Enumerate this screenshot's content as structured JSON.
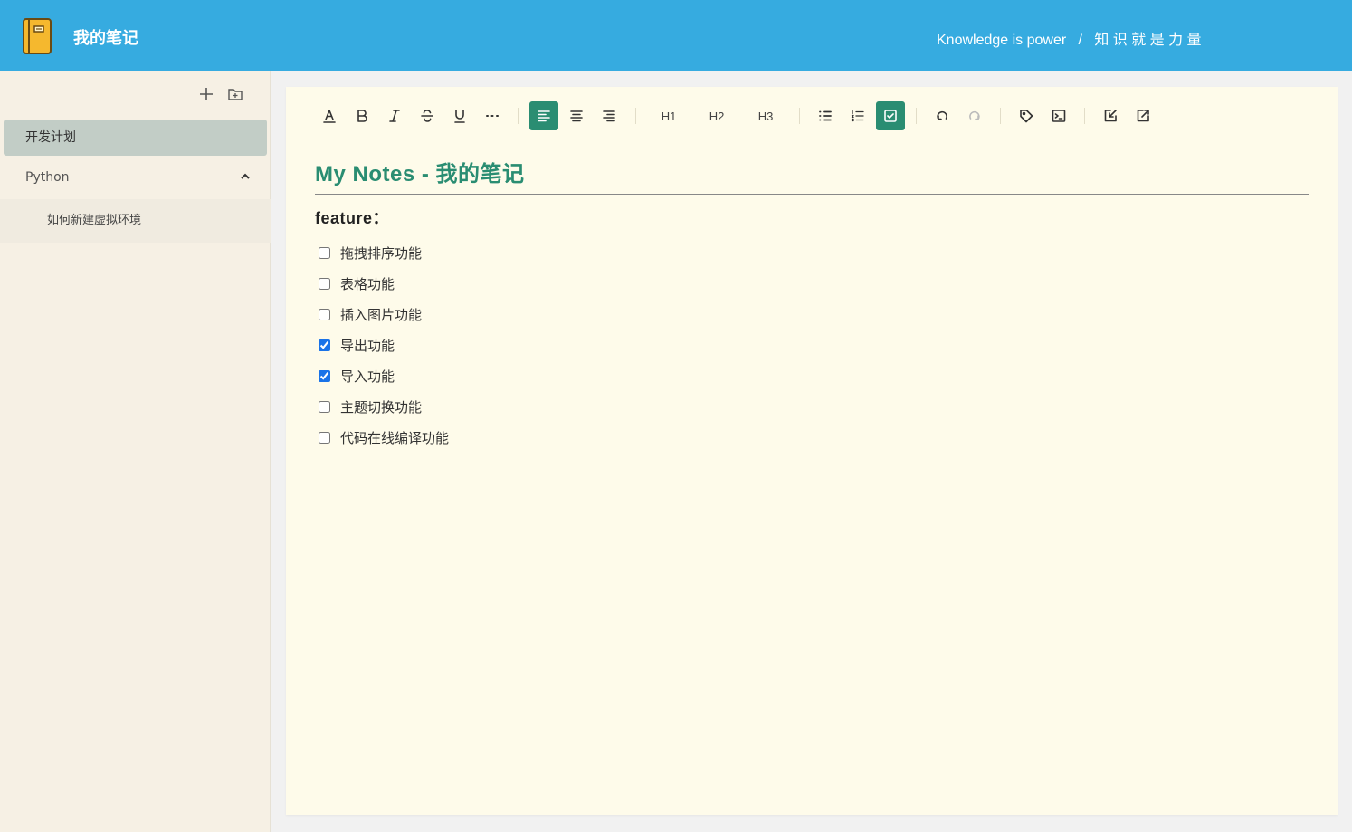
{
  "header": {
    "app_title": "我的笔记",
    "motto": "Knowledge is power   /   知 识 就 是 力 量",
    "logo_icon": "notebook-icon"
  },
  "sidebar": {
    "tools": [
      {
        "name": "add-note",
        "icon": "plus-icon"
      },
      {
        "name": "add-folder",
        "icon": "folder-plus-icon"
      }
    ],
    "items": [
      {
        "label": "开发计划",
        "active": true
      }
    ],
    "group": {
      "label": "Python",
      "expanded": true,
      "children": [
        {
          "label": "如何新建虚拟环境"
        }
      ]
    }
  },
  "toolbar": {
    "h1": "H1",
    "h2": "H2",
    "h3": "H3",
    "active_color": "#2a8d72"
  },
  "document": {
    "title": "My Notes - 我的笔记",
    "subtitle": "feature：",
    "tasks": [
      {
        "label": "拖拽排序功能",
        "checked": false
      },
      {
        "label": "表格功能",
        "checked": false
      },
      {
        "label": "插入图片功能",
        "checked": false
      },
      {
        "label": "导出功能",
        "checked": true
      },
      {
        "label": "导入功能",
        "checked": true
      },
      {
        "label": "主题切换功能",
        "checked": false
      },
      {
        "label": "代码在线编译功能",
        "checked": false
      }
    ]
  },
  "colors": {
    "header_bg": "#36abe0",
    "sidebar_bg": "#f6f0e4",
    "editor_bg": "#fefbea",
    "accent": "#2a8d72"
  }
}
